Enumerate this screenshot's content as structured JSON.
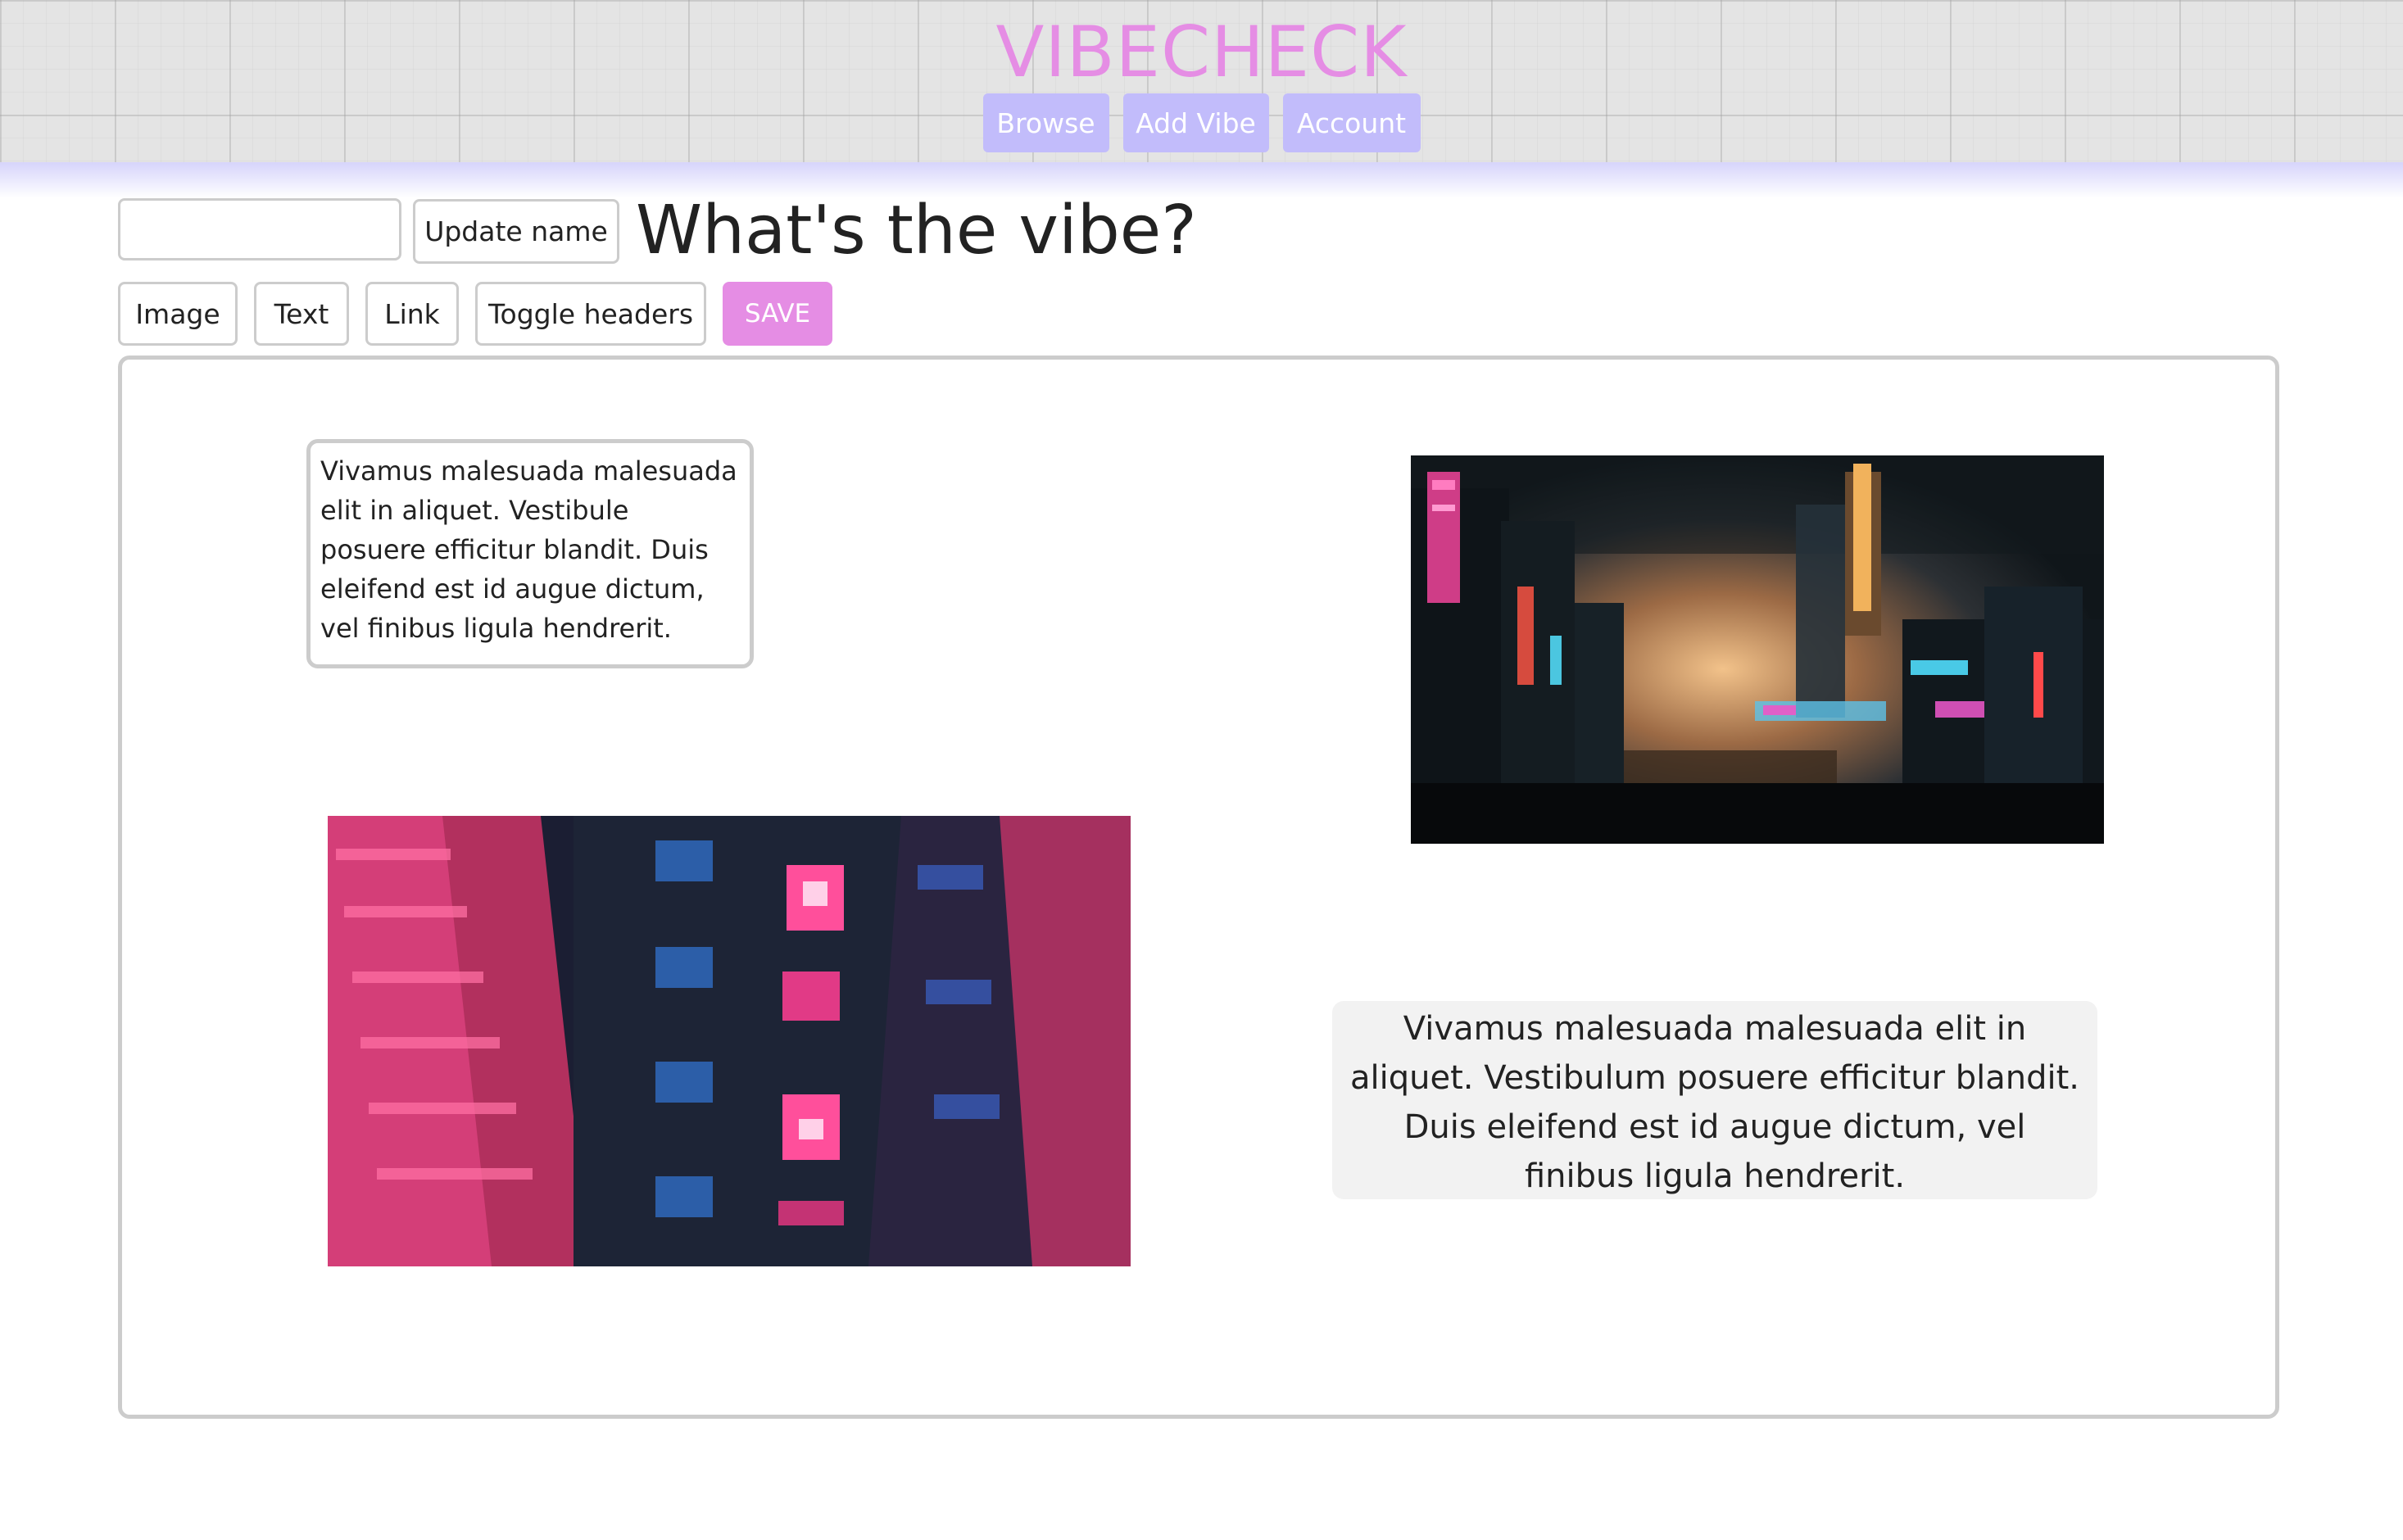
{
  "app": {
    "brand": "VIBECHECK",
    "nav": [
      {
        "label": "Browse"
      },
      {
        "label": "Add Vibe"
      },
      {
        "label": "Account"
      }
    ]
  },
  "toolbar": {
    "name_input_value": "",
    "update_name_label": "Update name",
    "page_title": "What's the vibe?",
    "image_label": "Image",
    "text_label": "Text",
    "link_label": "Link",
    "toggle_headers_label": "Toggle headers",
    "save_label": "SAVE"
  },
  "canvas": {
    "text_block_1": "Vivamus malesuada malesuada elit in aliquet. Vestibule posuere efficitur blandit. Duis eleifend est id augue dictum, vel finibus ligula hendrerit.",
    "text_block_2": "Vivamus malesuada malesuada elit in aliquet. Vestibulum posuere efficitur blandit. Duis eleifend est id augue dictum, vel finibus ligula hendrerit."
  },
  "colors": {
    "brand": "#e58de4",
    "nav_button": "#c2bcfb",
    "save_button": "#e58de4",
    "border": "#cccccc"
  }
}
